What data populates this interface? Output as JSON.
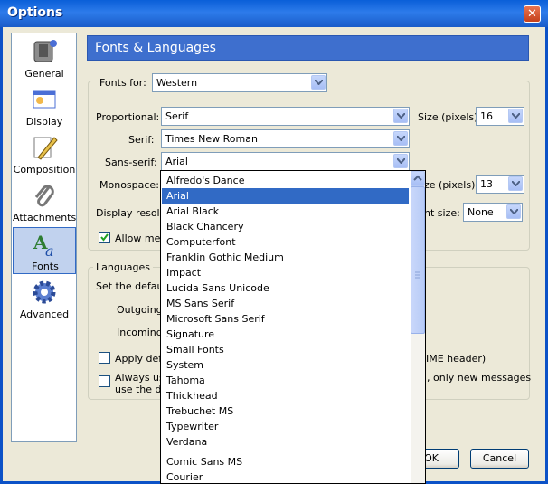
{
  "window": {
    "title": "Options",
    "close_glyph": "✕"
  },
  "sidebar": {
    "items": [
      {
        "label": "General",
        "icon": "general-icon"
      },
      {
        "label": "Display",
        "icon": "display-icon"
      },
      {
        "label": "Composition",
        "icon": "composition-icon"
      },
      {
        "label": "Attachments",
        "icon": "paperclip-icon"
      },
      {
        "label": "Fonts",
        "icon": "fonts-icon",
        "selected": true
      },
      {
        "label": "Advanced",
        "icon": "gear-icon"
      }
    ]
  },
  "header": {
    "title": "Fonts & Languages"
  },
  "fonts": {
    "fonts_for_label": "Fonts for:",
    "fonts_for_value": "Western",
    "proportional_label": "Proportional:",
    "proportional_value": "Serif",
    "size_label": "Size (pixels)",
    "proportional_size": "16",
    "serif_label": "Serif:",
    "serif_value": "Times New Roman",
    "sans_serif_label": "Sans-serif:",
    "sans_serif_value": "Arial",
    "monospace_label": "Monospace:",
    "monospace_size_label_partial": "ze (pixels)",
    "monospace_size": "13",
    "display_resolution_partial": "Display resoluti",
    "min_size_partial": "nt size:",
    "min_size_value": "None",
    "allow_partial": "Allow mess",
    "allow_checked": true
  },
  "languages": {
    "legend": "Languages",
    "set_default_partial": "Set the default",
    "outgoing_partial": "Outgoing I",
    "incoming_partial": "Incoming M",
    "apply_partial": "Apply defa",
    "mime_partial": "IME header)",
    "always_partial": "Always use",
    "only_new_partial": ", only new messages",
    "use_the_partial": "use the de"
  },
  "buttons": {
    "ok_partial": "OK",
    "cancel": "Cancel"
  },
  "dropdown": {
    "selected": "Arial",
    "options": [
      "Alfredo's Dance",
      "Arial",
      "Arial Black",
      "Black Chancery",
      "Computerfont",
      "Franklin Gothic Medium",
      "Impact",
      "Lucida Sans Unicode",
      "MS Sans Serif",
      "Microsoft Sans Serif",
      "Signature",
      "Small Fonts",
      "System",
      "Tahoma",
      "Thickhead",
      "Trebuchet MS",
      "Typewriter",
      "Verdana"
    ],
    "more_options": [
      "Comic Sans MS",
      "Courier"
    ]
  },
  "colors": {
    "accent": "#316AC5",
    "header": "#3E6FCE",
    "dialog": "#ECE9D8"
  }
}
